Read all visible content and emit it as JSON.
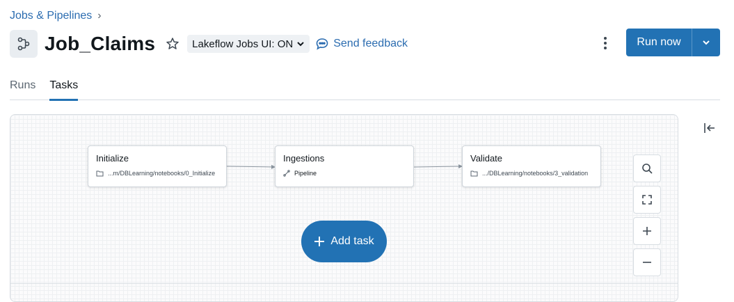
{
  "breadcrumb": {
    "parent": "Jobs & Pipelines",
    "separator": "›"
  },
  "header": {
    "job_icon": "workflow-icon",
    "title": "Job_Claims",
    "favorite_icon": "star-icon",
    "ui_toggle_label": "Lakeflow Jobs UI: ON",
    "feedback_label": "Send feedback"
  },
  "actions": {
    "run_label": "Run now",
    "more_icon": "kebab-icon",
    "dropdown_icon": "chevron-down-icon"
  },
  "tabs": [
    {
      "label": "Runs",
      "active": false
    },
    {
      "label": "Tasks",
      "active": true
    }
  ],
  "graph": {
    "nodes": [
      {
        "title": "Initialize",
        "type_icon": "folder-icon",
        "subtitle": "...m/DBLearning/notebooks/0_Initialize"
      },
      {
        "title": "Ingestions",
        "type_icon": "pipeline-icon",
        "subtitle": "Pipeline"
      },
      {
        "title": "Validate",
        "type_icon": "folder-icon",
        "subtitle": ".../DBLearning/notebooks/3_validation"
      }
    ],
    "add_task_label": "Add task"
  },
  "colors": {
    "accent": "#2272b4",
    "link": "#2b6cb0"
  }
}
